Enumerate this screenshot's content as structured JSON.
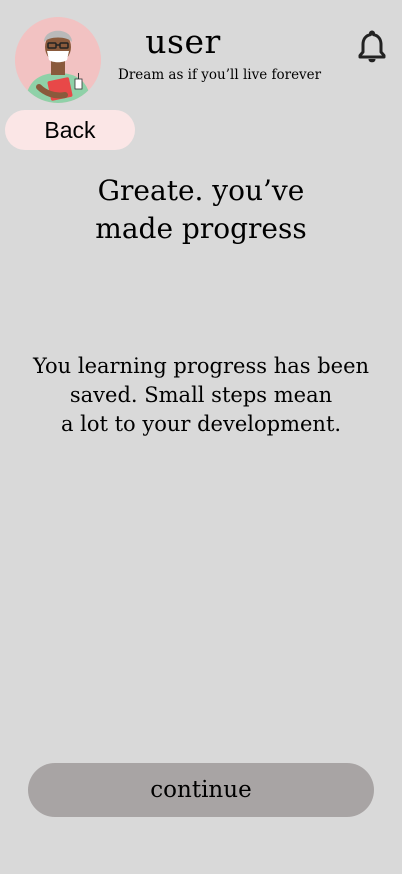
{
  "header": {
    "username": "user",
    "tagline": "Dream as if you’ll live forever",
    "avatar_icon": "doctor-avatar-icon",
    "notification_icon": "bell-icon"
  },
  "nav": {
    "back_label": "Back"
  },
  "main": {
    "heading_line1": "Greate. you’ve",
    "heading_line2": "made progress",
    "message_line1": "You learning progress has been",
    "message_line2": "saved. Small steps mean",
    "message_line3": "a lot to your development."
  },
  "footer": {
    "continue_label": "continue"
  },
  "colors": {
    "background": "#d9d9d9",
    "back_button": "#fbe6e6",
    "continue_button": "#a8a4a4",
    "avatar_bg": "#f2c2c2"
  }
}
